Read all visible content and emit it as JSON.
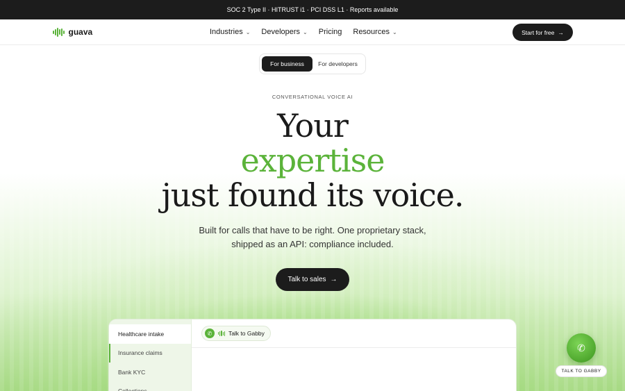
{
  "announcement": "SOC 2 Type II · HITRUST i1 · PCI DSS L1 · Reports available",
  "brand": {
    "name": "guava",
    "accent": "#5bb33a",
    "dark": "#1c1c1c"
  },
  "nav": {
    "items": [
      {
        "label": "Industries",
        "has_dropdown": true
      },
      {
        "label": "Developers",
        "has_dropdown": true
      },
      {
        "label": "Pricing",
        "has_dropdown": false
      },
      {
        "label": "Resources",
        "has_dropdown": true
      }
    ],
    "cta": "Start for free"
  },
  "audience_toggle": {
    "options": [
      "For business",
      "For developers"
    ],
    "selected": "For business"
  },
  "hero": {
    "eyebrow": "CONVERSATIONAL VOICE AI",
    "line1": "Your",
    "line2": "expertise",
    "line3": "just found its voice.",
    "subtext_line1": "Built for calls that have to be right. One proprietary stack,",
    "subtext_line2": "shipped as an API: compliance included.",
    "cta": "Talk to sales"
  },
  "demo": {
    "use_cases": [
      "Healthcare intake",
      "Insurance claims",
      "Bank KYC",
      "Collections"
    ],
    "selected": "Healthcare intake",
    "call_button": "Talk to Gabby"
  },
  "floating": {
    "label": "TALK TO GABBY"
  },
  "icons": {
    "arrow": "arrow-right-icon",
    "chevron": "chevron-down-icon",
    "phone": "phone-icon",
    "logo": "waveform-logo-icon"
  }
}
